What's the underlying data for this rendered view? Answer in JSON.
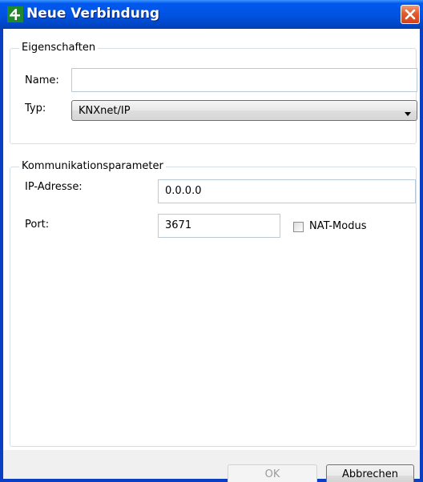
{
  "window": {
    "title": "Neue Verbindung"
  },
  "eigenschaften": {
    "legend": "Eigenschaften",
    "name_label": "Name:",
    "name_value": "",
    "typ_label": "Typ:",
    "typ_selected": "KNXnet/IP"
  },
  "kommunikation": {
    "legend": "Kommunikationsparameter",
    "ip_label": "IP-Adresse:",
    "ip_value": "0.0.0.0",
    "port_label": "Port:",
    "port_value": "3671",
    "nat_label": "NAT-Modus",
    "nat_checked": false
  },
  "buttons": {
    "ok_label": "OK",
    "cancel_label": "Abbrechen"
  },
  "colors": {
    "titlebar": "#0054e3",
    "close": "#e25a2f",
    "dialog_background": "#f0f0f0",
    "panel_background": "#ffffff"
  },
  "icons": {
    "app": "app-logo-icon",
    "close": "close-icon",
    "dropdown": "chevron-down-icon"
  }
}
